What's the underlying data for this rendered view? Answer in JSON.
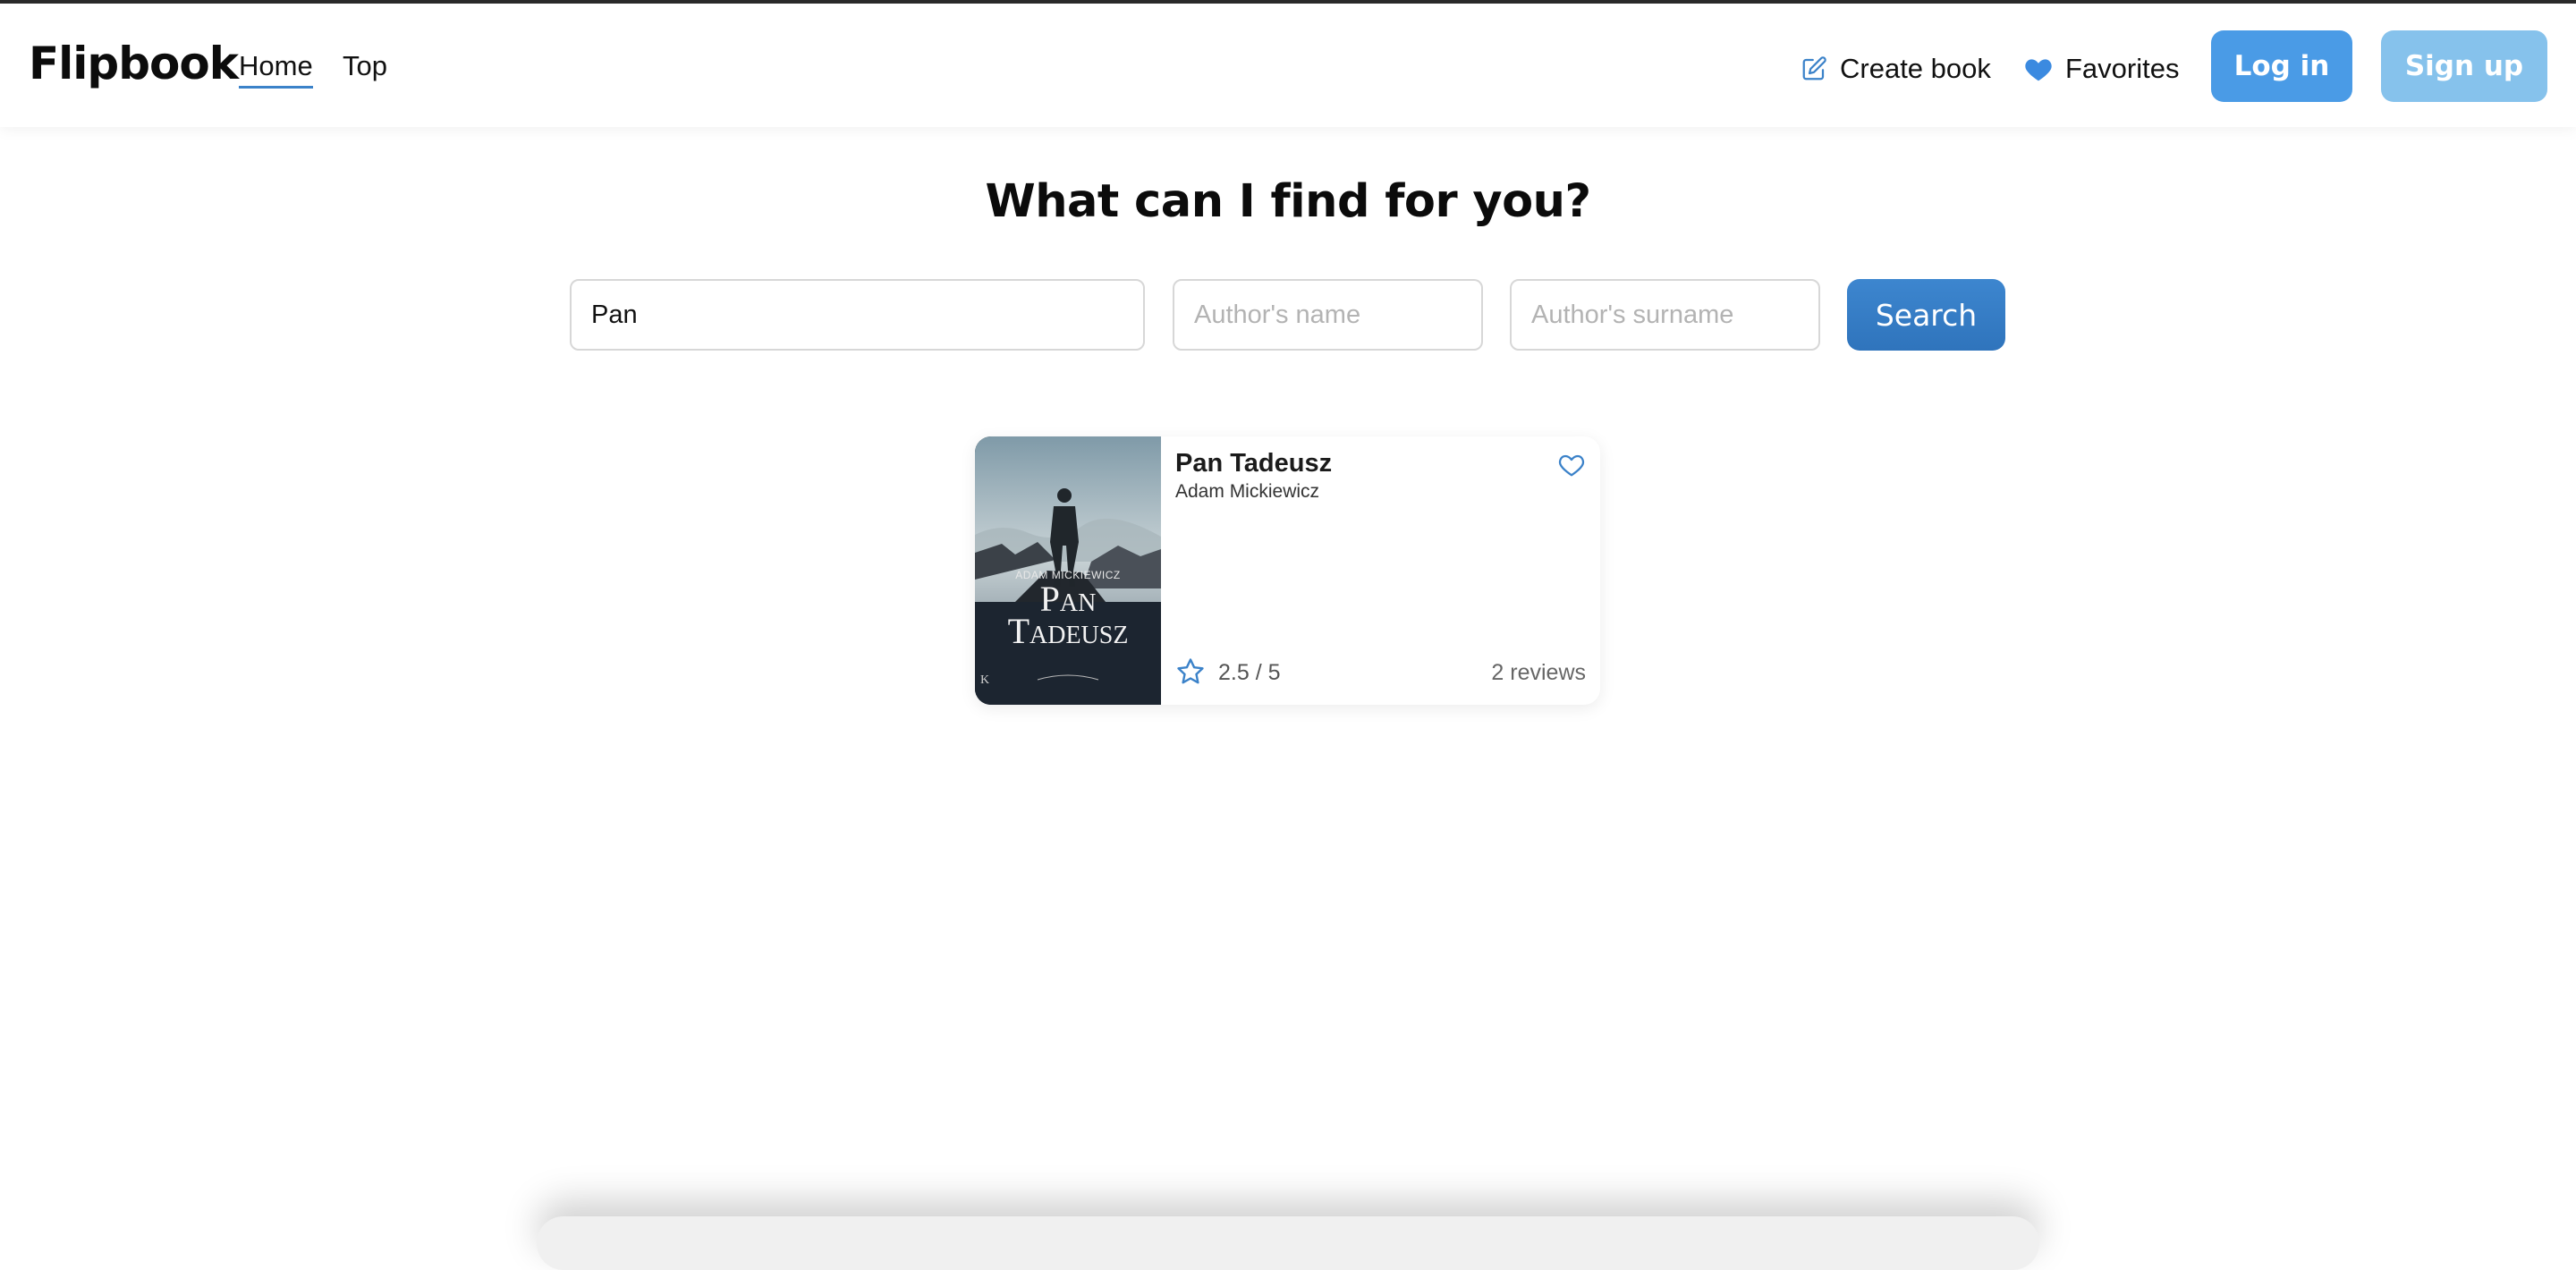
{
  "header": {
    "logo": "Flipbook",
    "nav": [
      {
        "label": "Home",
        "active": true
      },
      {
        "label": "Top",
        "active": false
      }
    ],
    "create_book_label": "Create book",
    "favorites_label": "Favorites",
    "login_label": "Log in",
    "signup_label": "Sign up"
  },
  "search": {
    "heading": "What can I find for you?",
    "title_value": "Pan",
    "author_name_placeholder": "Author's name",
    "author_surname_placeholder": "Author's surname",
    "button_label": "Search"
  },
  "results": [
    {
      "title": "Pan Tadeusz",
      "author": "Adam Mickiewicz",
      "rating_text": "2.5 / 5",
      "reviews_text": "2 reviews",
      "cover": {
        "author_text": "ADAM MICKIEWICZ",
        "title_line1": "Pan",
        "title_line2": "Tadeusz"
      }
    }
  ],
  "colors": {
    "accent": "#3b82c9",
    "login_bg": "#4a9be6",
    "signup_bg": "#86c2ec",
    "search_bg": "#2f74bc",
    "icon_blue": "#3b82c9"
  },
  "icons": {
    "create_book": "edit-icon",
    "favorites": "heart-filled-icon",
    "card_favorite": "heart-outline-icon",
    "rating": "star-outline-icon"
  }
}
